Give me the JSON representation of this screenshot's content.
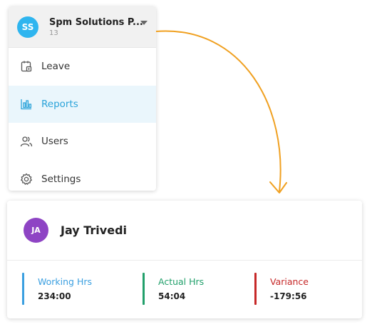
{
  "org": {
    "avatar_initials": "SS",
    "name": "Spm Solutions P...",
    "count": "13",
    "avatar_color": "#2fb5ef"
  },
  "menu": {
    "items": [
      {
        "label": "Leave",
        "icon": "calendar-leave-icon",
        "active": false
      },
      {
        "label": "Reports",
        "icon": "bar-chart-icon",
        "active": true
      },
      {
        "label": "Users",
        "icon": "users-icon",
        "active": false
      },
      {
        "label": "Settings",
        "icon": "gear-icon",
        "active": false
      }
    ],
    "active_color": "#2aa3d9"
  },
  "connector": {
    "color": "#f0a020"
  },
  "employee": {
    "initials": "JA",
    "name": "Jay Trivedi",
    "avatar_color": "#8e44c4",
    "stats": [
      {
        "label": "Working Hrs",
        "value": "234:00",
        "color": "#3b9fe0"
      },
      {
        "label": "Actual Hrs",
        "value": "54:04",
        "color": "#22a06b"
      },
      {
        "label": "Variance",
        "value": "-179:56",
        "color": "#c62828"
      }
    ]
  }
}
